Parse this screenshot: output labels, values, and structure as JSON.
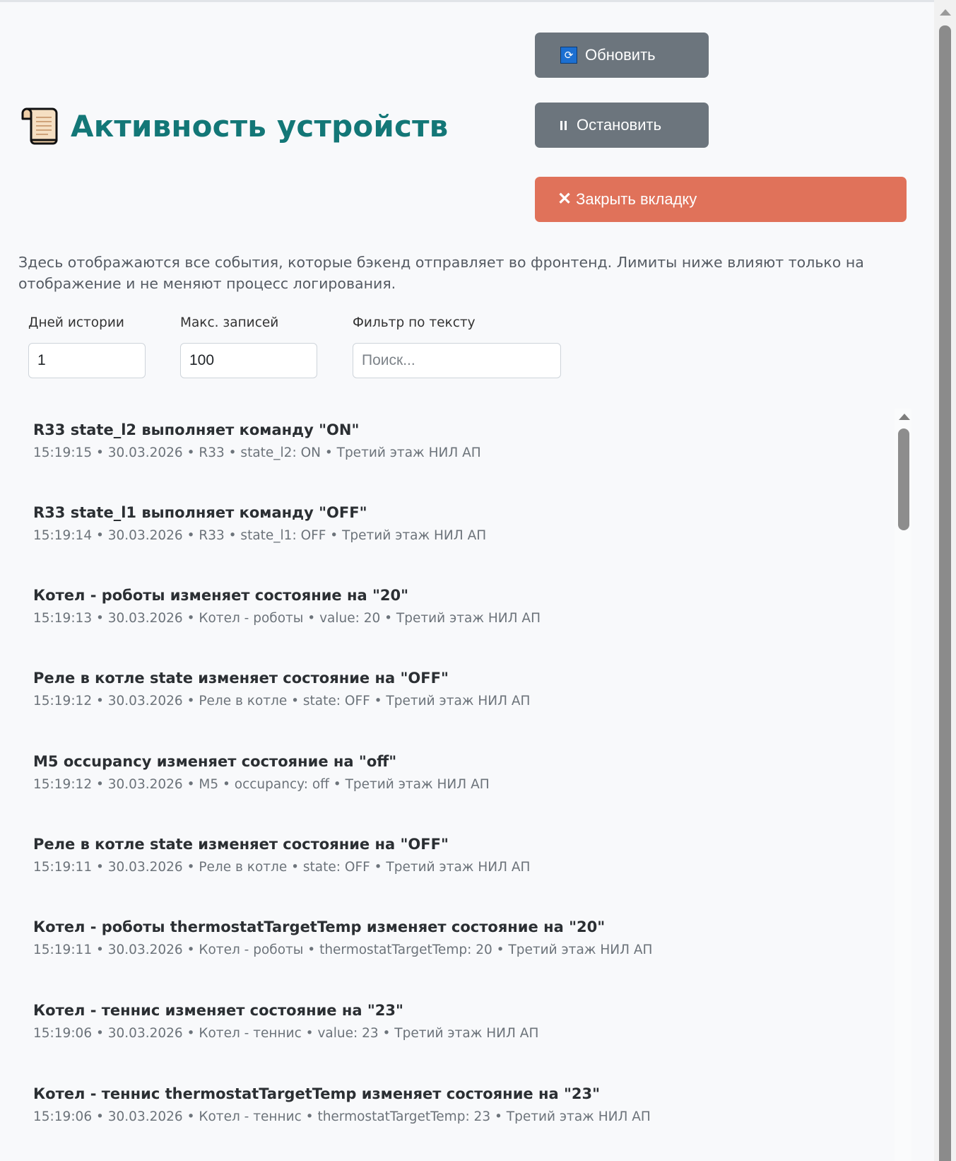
{
  "header": {
    "title": "Активность устройств"
  },
  "toolbar": {
    "refresh_label": "Обновить",
    "stop_label": "Остановить",
    "close_label": "Закрыть вкладку"
  },
  "description": "Здесь отображаются все события, которые бэкенд отправляет во фронтенд. Лимиты ниже влияют только на отображение и не меняют процесс логирования.",
  "filters": {
    "days_label": "Дней истории",
    "days_value": "1",
    "max_label": "Макс. записей",
    "max_value": "100",
    "text_label": "Фильтр по тексту",
    "text_value": "",
    "text_placeholder": "Поиск..."
  },
  "events": [
    {
      "title": "R33 state_l2 выполняет команду \"ON\"",
      "meta": "15:19:15 • 30.03.2026 • R33 • state_l2: ON • Третий этаж НИЛ АП"
    },
    {
      "title": "R33 state_l1 выполняет команду \"OFF\"",
      "meta": "15:19:14 • 30.03.2026 • R33 • state_l1: OFF • Третий этаж НИЛ АП"
    },
    {
      "title": "Котел - роботы изменяет состояние на \"20\"",
      "meta": "15:19:13 • 30.03.2026 • Котел - роботы • value: 20 • Третий этаж НИЛ АП"
    },
    {
      "title": "Реле в котле state изменяет состояние на \"OFF\"",
      "meta": "15:19:12 • 30.03.2026 • Реле в котле • state: OFF • Третий этаж НИЛ АП"
    },
    {
      "title": "M5 occupancy изменяет состояние на \"off\"",
      "meta": "15:19:12 • 30.03.2026 • M5 • occupancy: off • Третий этаж НИЛ АП"
    },
    {
      "title": "Реле в котле state изменяет состояние на \"OFF\"",
      "meta": "15:19:11 • 30.03.2026 • Реле в котле • state: OFF • Третий этаж НИЛ АП"
    },
    {
      "title": "Котел - роботы thermostatTargetTemp изменяет состояние на \"20\"",
      "meta": "15:19:11 • 30.03.2026 • Котел - роботы • thermostatTargetTemp: 20 • Третий этаж НИЛ АП"
    },
    {
      "title": "Котел - теннис изменяет состояние на \"23\"",
      "meta": "15:19:06 • 30.03.2026 • Котел - теннис • value: 23 • Третий этаж НИЛ АП"
    },
    {
      "title": "Котел - теннис thermostatTargetTemp изменяет состояние на \"23\"",
      "meta": "15:19:06 • 30.03.2026 • Котел - теннис • thermostatTargetTemp: 23 • Третий этаж НИЛ АП"
    }
  ]
}
